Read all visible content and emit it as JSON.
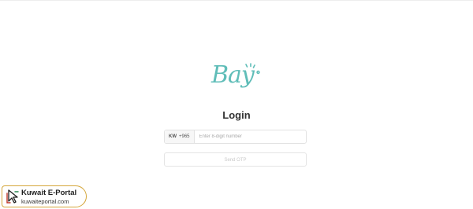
{
  "brand": {
    "logo_text": "Bay",
    "accent_color": "#5fbdb8"
  },
  "login": {
    "title": "Login",
    "country_code_label": "KW",
    "dial_code": "+965",
    "phone_placeholder": "Enter 8-digit number",
    "otp_button_label": "Send OTP"
  },
  "watermark": {
    "title": "Kuwait E-Portal",
    "url": "kuwaiteportal.com",
    "border_color": "#d4a63a"
  }
}
